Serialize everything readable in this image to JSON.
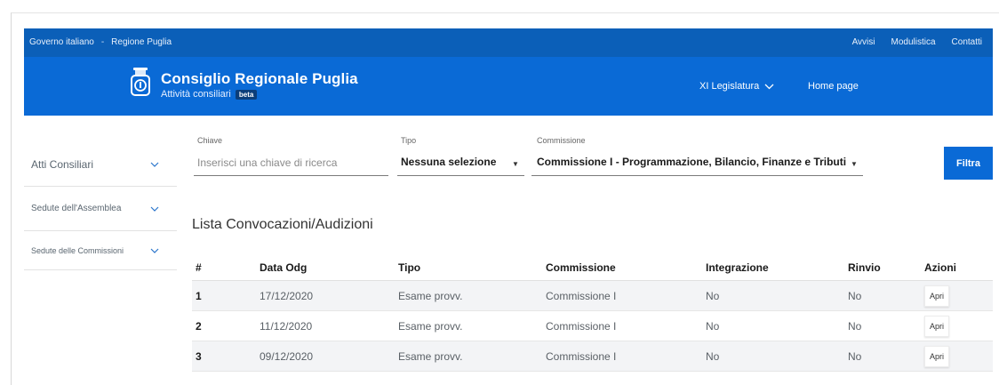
{
  "topbar": {
    "links_left": [
      "Governo italiano",
      "Regione Puglia"
    ],
    "separator": "-",
    "links_right": [
      "Avvisi",
      "Modulistica",
      "Contatti"
    ]
  },
  "header": {
    "title": "Consiglio Regionale Puglia",
    "subtitle": "Attività consiliari",
    "badge": "beta",
    "legislatura": "XI Legislatura",
    "home": "Home page"
  },
  "sidebar": {
    "items": [
      {
        "label": "Atti Consiliari",
        "icon": "chevron-down-icon"
      },
      {
        "label": "Sedute dell'Assemblea",
        "icon": "chevron-down-icon"
      },
      {
        "label": "Sedute delle Commissioni",
        "icon": "chevron-down-icon"
      }
    ]
  },
  "filters": {
    "chiave": {
      "label": "Chiave",
      "placeholder": "Inserisci una chiave di ricerca"
    },
    "tipo": {
      "label": "Tipo",
      "value": "Nessuna selezione"
    },
    "commissione": {
      "label": "Commissione",
      "value": "Commissione I - Programmazione, Bilancio, Finanze e Tributi"
    },
    "button": "Filtra"
  },
  "list": {
    "title": "Lista Convocazioni/Audizioni",
    "columns": [
      "#",
      "Data Odg",
      "Tipo",
      "Commissione",
      "Integrazione",
      "Rinvio",
      "Azioni"
    ],
    "rows": [
      {
        "n": "1",
        "data": "17/12/2020",
        "tipo": "Esame provv.",
        "commissione": "Commissione I",
        "integrazione": "No",
        "rinvio": "No",
        "azione": "Apri"
      },
      {
        "n": "2",
        "data": "11/12/2020",
        "tipo": "Esame provv.",
        "commissione": "Commissione I",
        "integrazione": "No",
        "rinvio": "No",
        "azione": "Apri"
      },
      {
        "n": "3",
        "data": "09/12/2020",
        "tipo": "Esame provv.",
        "commissione": "Commissione I",
        "integrazione": "No",
        "rinvio": "No",
        "azione": "Apri"
      }
    ]
  },
  "colors": {
    "header_blue": "#0a6ad6",
    "topbar_blue": "#0b5fb8",
    "accent": "#2a75cc"
  }
}
